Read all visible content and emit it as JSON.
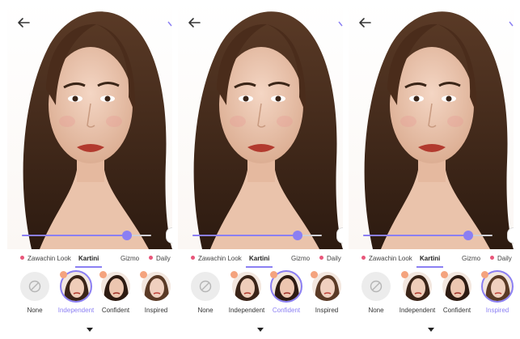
{
  "colors": {
    "accent": "#8b7ff3",
    "dot": "#e8567a",
    "badge": "#f4a37e"
  },
  "panels": [
    {
      "slider": {
        "value": 0.81
      },
      "tabs": [
        {
          "label": "Zawachin Look",
          "dot": true
        },
        {
          "label": "Kartini",
          "dot": false,
          "active": true
        },
        {
          "label": "Gizmo",
          "dot": false
        },
        {
          "label": "Daily",
          "dot": true
        }
      ],
      "looks": [
        {
          "label": "None"
        },
        {
          "label": "Independent",
          "selected": true
        },
        {
          "label": "Confident"
        },
        {
          "label": "Inspired"
        }
      ]
    },
    {
      "slider": {
        "value": 0.81
      },
      "tabs": [
        {
          "label": "Zawachin Look",
          "dot": true
        },
        {
          "label": "Kartini",
          "dot": false,
          "active": true
        },
        {
          "label": "Gizmo",
          "dot": false
        },
        {
          "label": "Daily",
          "dot": true
        }
      ],
      "looks": [
        {
          "label": "None"
        },
        {
          "label": "Independent"
        },
        {
          "label": "Confident",
          "selected": true
        },
        {
          "label": "Inspired"
        }
      ]
    },
    {
      "slider": {
        "value": 0.81
      },
      "tabs": [
        {
          "label": "Zawachin Look",
          "dot": true
        },
        {
          "label": "Kartini",
          "dot": false,
          "active": true
        },
        {
          "label": "Gizmo",
          "dot": false
        },
        {
          "label": "Daily",
          "dot": true
        }
      ],
      "looks": [
        {
          "label": "None"
        },
        {
          "label": "Independent"
        },
        {
          "label": "Confident"
        },
        {
          "label": "Inspired",
          "selected": true
        }
      ]
    }
  ],
  "icons": {
    "back": "arrow-left-icon",
    "confirm": "check-icon",
    "none": "prohibit-icon",
    "expand": "caret-down-icon"
  }
}
